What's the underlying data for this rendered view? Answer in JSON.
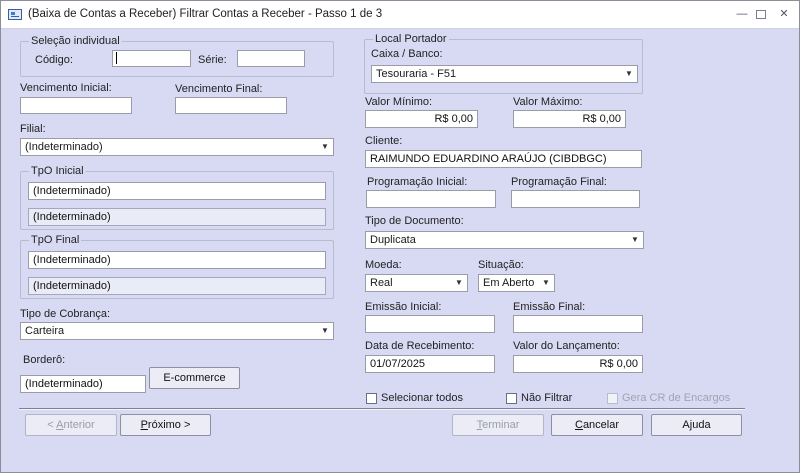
{
  "window": {
    "title": "(Baixa de Contas a Receber) Filtrar Contas a Receber - Passo 1 de 3",
    "minimize": "—",
    "restore": "▫",
    "close": "✕"
  },
  "selecao_individual": {
    "legend": "Seleção individual",
    "codigo_label": "Código:",
    "codigo_value": "",
    "serie_label": "Série:",
    "serie_value": ""
  },
  "vencimento": {
    "inicial_label": "Vencimento Inicial:",
    "inicial_value": "",
    "final_label": "Vencimento Final:",
    "final_value": ""
  },
  "filial": {
    "label": "Filial:",
    "value": "(Indeterminado)"
  },
  "tpo_inicial": {
    "legend": "TpO Inicial",
    "value1": "(Indeterminado)",
    "value2": "(Indeterminado)"
  },
  "tpo_final": {
    "legend": "TpO Final",
    "value1": "(Indeterminado)",
    "value2": "(Indeterminado)"
  },
  "tipo_cobranca": {
    "label": "Tipo de Cobrança:",
    "value": "Carteira"
  },
  "bordero": {
    "label": "Borderô:",
    "value": "(Indeterminado)",
    "button": "E-commerce"
  },
  "local_portador": {
    "legend": "Local Portador",
    "caixa_label": "Caixa / Banco:",
    "caixa_value": "Tesouraria - F51"
  },
  "valores": {
    "minimo_label": "Valor Mínimo:",
    "minimo_value": "R$ 0,00",
    "maximo_label": "Valor Máximo:",
    "maximo_value": "R$ 0,00"
  },
  "cliente": {
    "label": "Cliente:",
    "value": "RAIMUNDO EDUARDINO ARAÚJO (CIBDBGC)"
  },
  "programacao": {
    "inicial_label": "Programação Inicial:",
    "inicial_value": "",
    "final_label": "Programação Final:",
    "final_value": ""
  },
  "tipo_documento": {
    "label": "Tipo de Documento:",
    "value": "Duplicata"
  },
  "moeda": {
    "label": "Moeda:",
    "value": "Real"
  },
  "situacao": {
    "label": "Situação:",
    "value": "Em Aberto"
  },
  "emissao": {
    "inicial_label": "Emissão Inicial:",
    "inicial_value": "",
    "final_label": "Emissão Final:",
    "final_value": ""
  },
  "recebimento": {
    "label": "Data de Recebimento:",
    "value": "01/07/2025"
  },
  "lancamento": {
    "label": "Valor do Lançamento:",
    "value": "R$ 0,00"
  },
  "checkboxes": {
    "selecionar_todos": "Selecionar todos",
    "nao_filtrar": "Não Filtrar",
    "gera_cr": "Gera CR de Encargos"
  },
  "buttons": {
    "anterior_prefix": "< ",
    "anterior_key": "A",
    "anterior_rest": "nterior",
    "proximo_key": "P",
    "proximo_rest": "róximo >",
    "terminar_key": "T",
    "terminar_rest": "erminar",
    "cancelar_key": "C",
    "cancelar_rest": "ancelar",
    "ajuda": "Ajuda"
  }
}
